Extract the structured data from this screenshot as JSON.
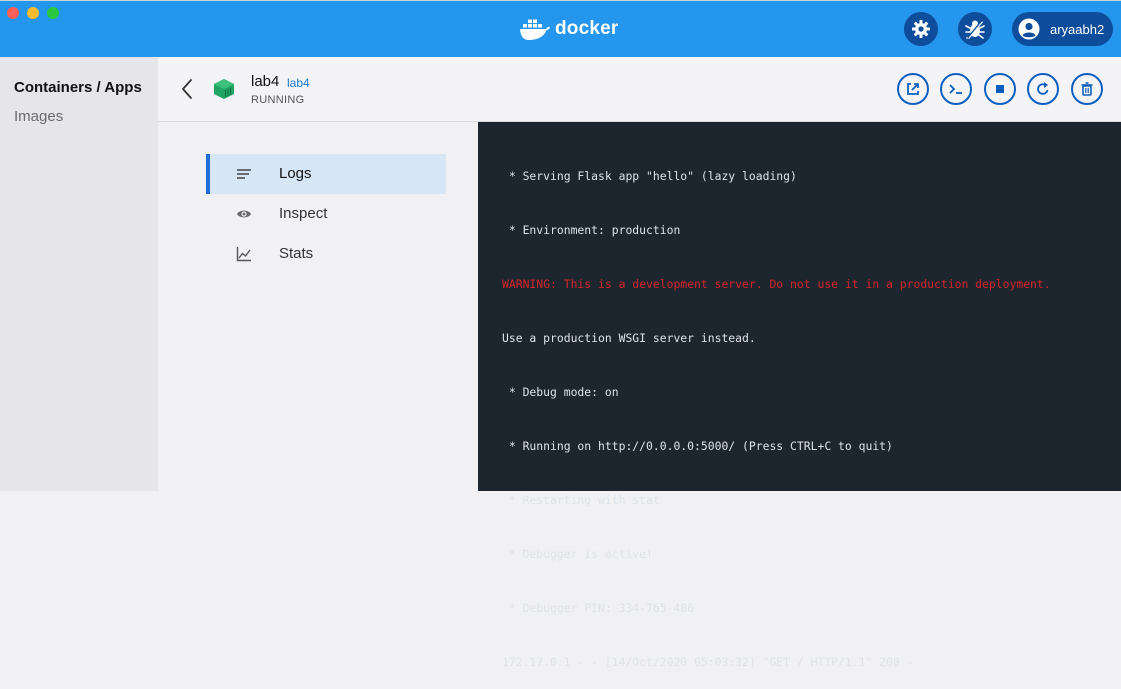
{
  "window": {
    "brand": "docker",
    "account_name": "aryaabh2"
  },
  "sidebar": {
    "items": [
      {
        "label": "Containers / Apps"
      },
      {
        "label": "Images"
      }
    ]
  },
  "container": {
    "name": "lab4",
    "image": "lab4",
    "status": "RUNNING"
  },
  "actions": [
    {
      "name": "open-in-browser",
      "icon": "external-link-icon"
    },
    {
      "name": "cli",
      "icon": "terminal-icon"
    },
    {
      "name": "stop",
      "icon": "stop-icon"
    },
    {
      "name": "restart",
      "icon": "restart-icon"
    },
    {
      "name": "delete",
      "icon": "trash-icon"
    }
  ],
  "tabs": [
    {
      "label": "Logs",
      "icon": "lines-icon",
      "selected": true
    },
    {
      "label": "Inspect",
      "icon": "eye-icon",
      "selected": false
    },
    {
      "label": "Stats",
      "icon": "chart-icon",
      "selected": false
    }
  ],
  "logs": [
    {
      "text": " * Serving Flask app \"hello\" (lazy loading)",
      "level": "info"
    },
    {
      "text": " * Environment: production",
      "level": "info"
    },
    {
      "text": "WARNING: This is a development server. Do not use it in a production deployment.",
      "level": "warning"
    },
    {
      "text": "Use a production WSGI server instead.",
      "level": "info"
    },
    {
      "text": " * Debug mode: on",
      "level": "info"
    },
    {
      "text": " * Running on http://0.0.0.0:5000/ (Press CTRL+C to quit)",
      "level": "info"
    },
    {
      "text": " * Restarting with stat",
      "level": "info"
    },
    {
      "text": " * Debugger is active!",
      "level": "info"
    },
    {
      "text": " * Debugger PIN: 334-765-486",
      "level": "info"
    },
    {
      "text": "172.17.0.1 - - [14/Oct/2020 05:03:32] \"GET / HTTP/1.1\" 200 -",
      "level": "info"
    }
  ],
  "colors": {
    "topbar": "#2496ed",
    "button_dark": "#0d4d9b",
    "accent": "#1f6fd6",
    "console_bg": "#1d262e",
    "warning": "#d8232a",
    "running_green": "#1fa463"
  }
}
